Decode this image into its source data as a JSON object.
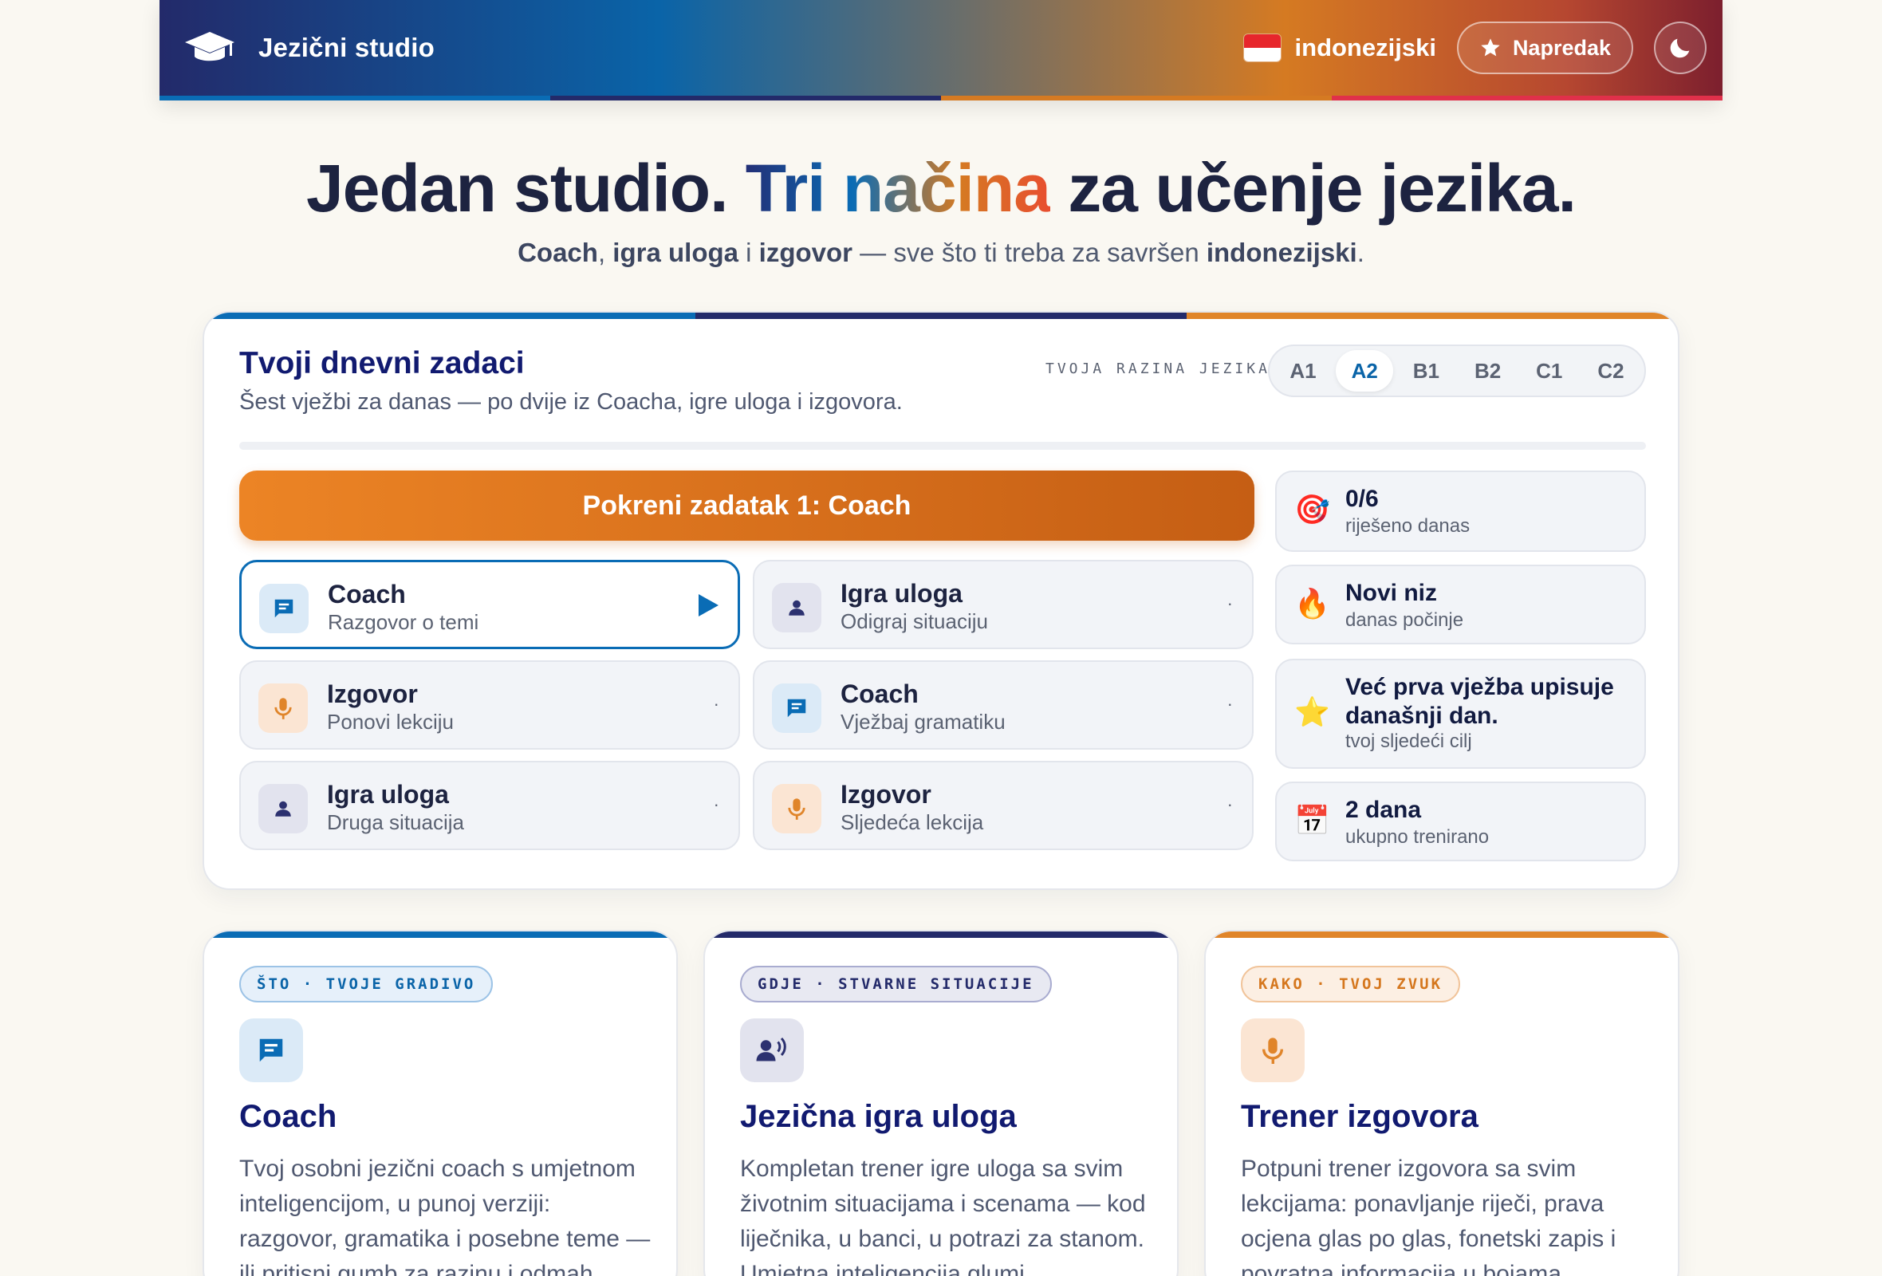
{
  "header": {
    "brand_name": "Jezični studio",
    "language": "indonezijski",
    "progress_label": "Napredak",
    "stripe_colors": [
      "#0a6cb5",
      "#232a6a",
      "#d57a22",
      "#e0304a"
    ]
  },
  "hero": {
    "title_start": "Jedan studio. ",
    "title_highlight": "Tri načina",
    "title_end": " za učenje jezika.",
    "sub_w1": "Coach",
    "sub_t1": ", ",
    "sub_w2": "igra uloga",
    "sub_t2": " i ",
    "sub_w3": "izgovor",
    "sub_t3": " — sve što ti treba za savršen ",
    "sub_w4": "indonezijski",
    "sub_t4": "."
  },
  "daily": {
    "title": "Tvoji dnevni zadaci",
    "description": "Šest vježbi za danas — po dvije iz Coacha, igre uloga i izgovora.",
    "level_label": "TVOJA RAZINA JEZIKA",
    "levels": [
      "A1",
      "A2",
      "B1",
      "B2",
      "C1",
      "C2"
    ],
    "selected_level": "A2",
    "start_button": "Pokreni zadatak 1: Coach",
    "tasks": [
      {
        "title": "Coach",
        "subtitle": "Razgovor o temi"
      },
      {
        "title": "Igra uloga",
        "subtitle": "Odigraj situaciju",
        "marker": "·"
      },
      {
        "title": "Izgovor",
        "subtitle": "Ponovi lekciju",
        "marker": "·"
      },
      {
        "title": "Coach",
        "subtitle": "Vježbaj gramatiku",
        "marker": "·"
      },
      {
        "title": "Igra uloga",
        "subtitle": "Druga situacija",
        "marker": "·"
      },
      {
        "title": "Izgovor",
        "subtitle": "Sljedeća lekcija",
        "marker": "·"
      }
    ],
    "stats": [
      {
        "icon": "🎯",
        "value": "0/6",
        "label": "riješeno danas"
      },
      {
        "icon": "🔥",
        "value": "Novi niz",
        "label": "danas počinje"
      },
      {
        "icon": "⭐",
        "value": "Već prva vježba upisuje današnji dan.",
        "label": "tvoj sljedeći cilj"
      },
      {
        "icon": "📅",
        "value": "2 dana",
        "label": "ukupno trenirano"
      }
    ]
  },
  "features": [
    {
      "tag": "ŠTO · TVOJE GRADIVO",
      "title": "Coach",
      "description": "Tvoj osobni jezični coach s umjetnom inteligencijom, u punoj verziji: razgovor, gramatika i posebne teme — ili pritisni gumb za razinu i odmah"
    },
    {
      "tag": "GDJE · STVARNE SITUACIJE",
      "title": "Jezična igra uloga",
      "description": "Kompletan trener igre uloga sa svim životnim situacijama i scenama — kod liječnika, u banci, u potrazi za stanom. Umjetna inteligencija glumi"
    },
    {
      "tag": "KAKO · TVOJ ZVUK",
      "title": "Trener izgovora",
      "description": "Potpuni trener izgovora sa svim lekcijama: ponavljanje riječi, prava ocjena glas po glas, fonetski zapis i povratna informacija u bojama"
    }
  ]
}
